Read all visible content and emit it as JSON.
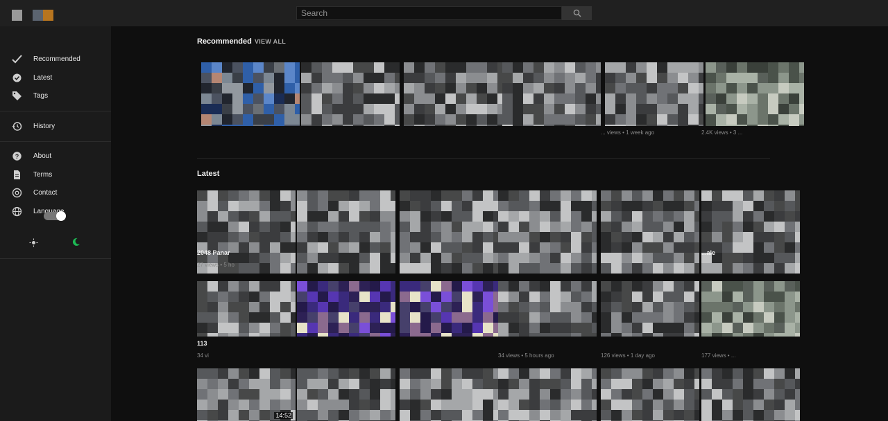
{
  "header": {
    "search": {
      "placeholder": "Search",
      "value": ""
    },
    "search_icon": "search-icon"
  },
  "sidebar": {
    "items": [
      {
        "label": "Recommended",
        "icon": "checkmark-icon"
      },
      {
        "label": "Latest",
        "icon": "badge-icon"
      },
      {
        "label": "Tags",
        "icon": "tag-icon"
      },
      {
        "label": "History",
        "icon": "history-icon"
      },
      {
        "label": "About",
        "icon": "question-icon"
      },
      {
        "label": "Terms",
        "icon": "document-icon"
      },
      {
        "label": "Contact",
        "icon": "at-icon"
      },
      {
        "label": "Language",
        "icon": "globe-icon"
      }
    ],
    "theme_toggle": {
      "state": "dark",
      "accent": "#1db954"
    }
  },
  "recommended": {
    "title": "Recommended",
    "view_all": "VIEW ALL",
    "cards": [
      {
        "meta": ""
      },
      {
        "meta": ""
      },
      {
        "meta": ""
      },
      {
        "meta": ""
      },
      {
        "meta": "... views • 1 week ago"
      },
      {
        "meta": "2.4K views • 3 ..."
      }
    ]
  },
  "latest": {
    "title": "Latest",
    "rows": [
      [
        {
          "title": "2048 Panar",
          "meta": "27 views • 5 ho",
          "duration": ""
        },
        {
          "title": "",
          "meta": "",
          "duration": ""
        },
        {
          "title": "",
          "meta": "",
          "duration": ""
        },
        {
          "title": "",
          "meta": "",
          "duration": ""
        },
        {
          "title": "",
          "meta": "",
          "duration": ""
        },
        {
          "title": "...ale",
          "meta": "",
          "duration": ""
        }
      ],
      [
        {
          "title": "113",
          "meta": "34 vi",
          "duration": ""
        },
        {
          "title": "",
          "meta": "",
          "duration": ""
        },
        {
          "title": "",
          "meta": "",
          "duration": ""
        },
        {
          "title": "",
          "meta": "34 views • 5 hours ago",
          "duration": ""
        },
        {
          "title": "",
          "meta": "126 views • 1 day ago",
          "duration": ""
        },
        {
          "title": "",
          "meta": "177 views • ...",
          "duration": ""
        }
      ],
      [
        {
          "title": "",
          "meta": "",
          "duration": "14:52"
        },
        {
          "title": "",
          "meta": "",
          "duration": ""
        },
        {
          "title": "",
          "meta": "",
          "duration": ""
        },
        {
          "title": "",
          "meta": "",
          "duration": ""
        },
        {
          "title": "",
          "meta": "",
          "duration": ""
        },
        {
          "title": "",
          "meta": "",
          "duration": ""
        }
      ]
    ]
  },
  "palettes": {
    "rec": [
      "#3a3f47",
      "#21252e",
      "#4b5260",
      "#1a2c55",
      "#2f5fa8",
      "#5b86c9",
      "#7c8793",
      "#b58673",
      "#6a6f75",
      "#92989f"
    ],
    "gray": [
      "#3b3c3e",
      "#56585b",
      "#707276",
      "#8b8d90",
      "#a5a7a9",
      "#2a2b2c",
      "#c3c4c5",
      "#474848"
    ],
    "violet": [
      "#241a4a",
      "#3a2a7c",
      "#5636b2",
      "#7a4fd8",
      "#2d2155",
      "#8b6a8e",
      "#46406b",
      "#e7e3c8"
    ],
    "greenish": [
      "#4a524a",
      "#6b746a",
      "#8c968b",
      "#a9b2a6",
      "#3a403a",
      "#c7cbc0",
      "#59605a"
    ]
  }
}
